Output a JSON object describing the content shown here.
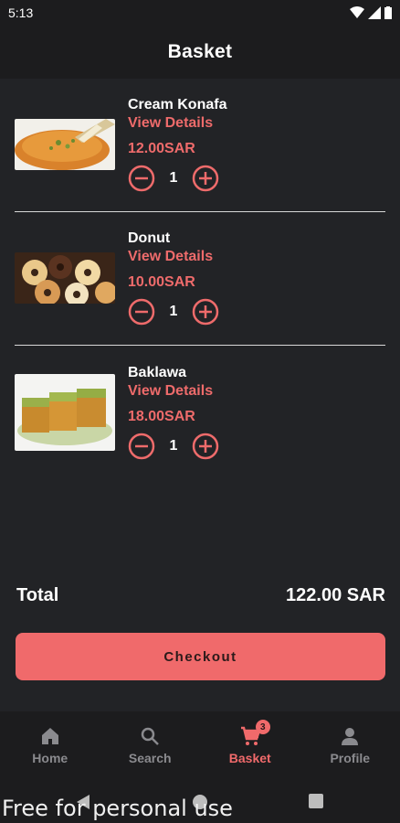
{
  "status_bar": {
    "time": "5:13"
  },
  "header": {
    "title": "Basket"
  },
  "basket": {
    "items": [
      {
        "name": "Cream Konafa",
        "link": "View Details",
        "price": "12.00SAR",
        "qty": "1",
        "image_icon": "konafa-photo"
      },
      {
        "name": "Donut",
        "link": "View Details",
        "price": "10.00SAR",
        "qty": "1",
        "image_icon": "donut-photo"
      },
      {
        "name": "Baklawa",
        "link": "View Details",
        "price": "18.00SAR",
        "qty": "1",
        "image_icon": "baklawa-photo"
      }
    ]
  },
  "total": {
    "label": "Total",
    "value": "122.00 SAR"
  },
  "checkout": {
    "label": "Checkout"
  },
  "nav": {
    "items": [
      {
        "label": "Home",
        "icon": "home-icon"
      },
      {
        "label": "Search",
        "icon": "search-icon"
      },
      {
        "label": "Basket",
        "icon": "cart-icon",
        "badge": "3"
      },
      {
        "label": "Profile",
        "icon": "person-icon"
      }
    ],
    "active": "Basket"
  },
  "watermark": "Free for personal use",
  "colors": {
    "accent": "#f06a6b",
    "background": "#222326",
    "bar": "#1c1c1e"
  }
}
